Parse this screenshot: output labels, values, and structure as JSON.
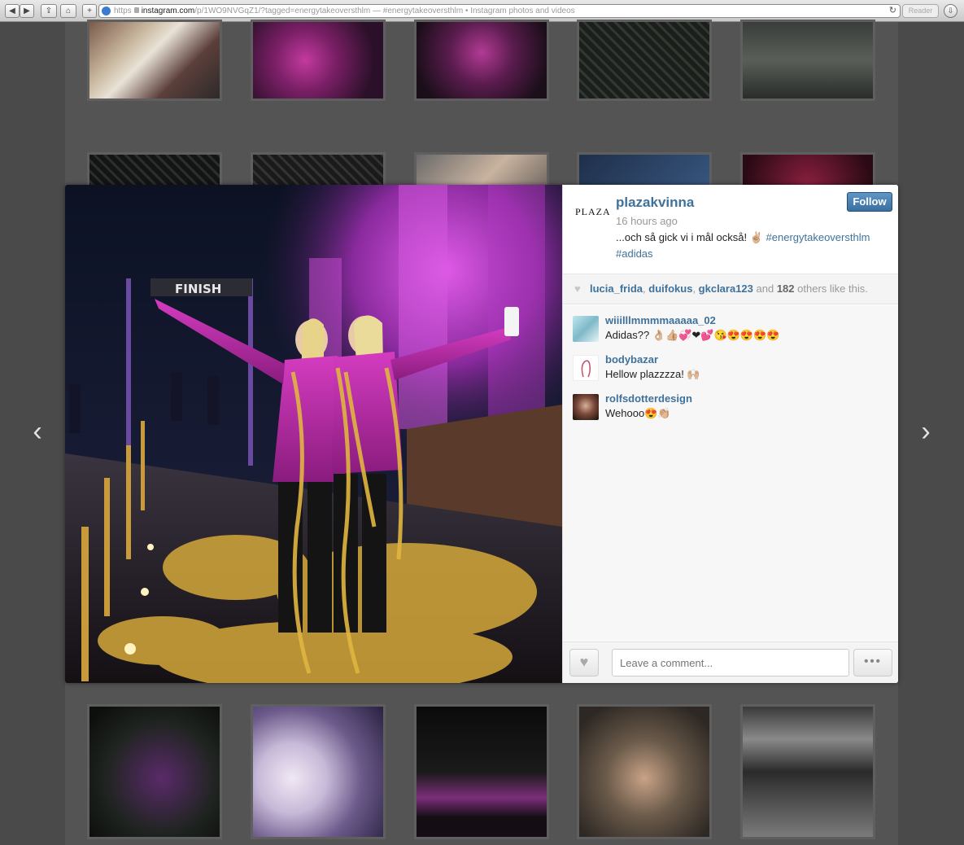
{
  "browser": {
    "url_scheme": "https",
    "url_host": "instagram.com",
    "url_path": "/p/1WO9NVGqZ1/?tagged=energytakeoversthlm",
    "page_title": " — #energytakeoversthlm • Instagram photos and videos",
    "reader_label": "Reader",
    "back_icon": "◀",
    "forward_icon": "▶",
    "share_icon": "⇪",
    "home_icon": "⌂",
    "add_tab_icon": "+",
    "reload_icon": "↻",
    "download_icon": "⇩"
  },
  "nav": {
    "prev_icon": "‹",
    "next_icon": "›"
  },
  "post": {
    "username": "plazakvinna",
    "avatar_text": "PLAZA",
    "time_ago": "16 hours ago",
    "caption_text": "...och så gick vi i mål också! ✌🏼 ",
    "hashtag_1": "#energytakeoversthlm",
    "hashtag_2": "#adidas",
    "follow_label": "Follow"
  },
  "likes": {
    "heart_icon": "♥",
    "user_1": "lucia_frida",
    "sep_1": ", ",
    "user_2": "duifokus",
    "sep_2": ", ",
    "user_3": "gkclara123",
    "and_text": " and ",
    "count": "182",
    "suffix": " others like this."
  },
  "comments": [
    {
      "user": "wiiilllmmmmaaaaa_02",
      "text": "Adidas?? 👌🏼👍🏼💞❤💕😘😍😍😍😍"
    },
    {
      "user": "bodybazar",
      "text": "Hellow plazzzza! 🙌🏼"
    },
    {
      "user": "rolfsdotterdesign",
      "text": "Wehooo😍👏🏼"
    }
  ],
  "footer": {
    "like_icon": "♥",
    "comment_placeholder": "Leave a comment...",
    "more_label": "•••"
  },
  "colors": {
    "link_blue": "#3f729b",
    "follow_button": "#4a80b0",
    "page_background": "#4a4a4a"
  }
}
